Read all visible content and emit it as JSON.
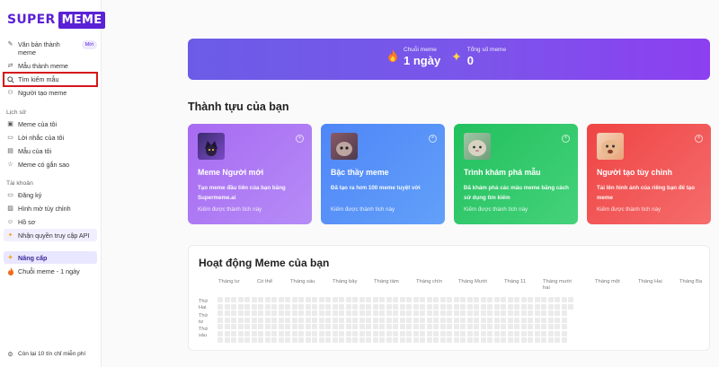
{
  "logo": {
    "part1": "SUPER",
    "part2": "MEME"
  },
  "sidebar": {
    "items": [
      {
        "label": "Văn bản thành meme",
        "icon": "pen-icon",
        "badge": "Mới"
      },
      {
        "label": "Mẫu thành meme",
        "icon": "image-swap-icon"
      },
      {
        "label": "Tìm kiếm mẫu",
        "icon": "search-icon"
      },
      {
        "label": "Người tạo meme",
        "icon": "person-plus-icon"
      }
    ],
    "history_title": "Lịch sử",
    "history": [
      {
        "label": "Meme của tôi",
        "icon": "image-icon"
      },
      {
        "label": "Lời nhắc của tôi",
        "icon": "message-icon"
      },
      {
        "label": "Mẫu của tôi",
        "icon": "template-icon"
      },
      {
        "label": "Meme có gắn sao",
        "icon": "star-icon"
      }
    ],
    "account_title": "Tài khoản",
    "account": [
      {
        "label": "Đăng ký",
        "icon": "card-icon"
      },
      {
        "label": "Hình mờ tùy chỉnh",
        "icon": "watermark-icon"
      },
      {
        "label": "Hồ sơ",
        "icon": "user-icon"
      },
      {
        "label": "Nhận quyền truy cập API",
        "icon": "sparkle-icon"
      }
    ],
    "upgrade": {
      "label": "Nâng cấp",
      "icon": "sparkle-icon"
    },
    "streak": {
      "label": "Chuỗi meme - 1 ngày",
      "icon": "fire-icon"
    },
    "bottom_note": "Còn lại 10 tín chỉ miễn phí"
  },
  "banner": {
    "streak_label": "Chuỗi meme",
    "streak_value": "1 ngày",
    "total_label": "Tổng số meme",
    "total_value": "0"
  },
  "achievements": {
    "title": "Thành tựu của bạn",
    "cards": [
      {
        "title": "Meme Người mới",
        "desc": "Tạo meme đầu tiên của bạn bằng Supermeme.ai",
        "earn": "Kiếm được thành tích này"
      },
      {
        "title": "Bậc thầy meme",
        "desc": "Đã tạo ra hơn 100 meme tuyệt vời",
        "earn": "Kiếm được thành tích này"
      },
      {
        "title": "Trình khám phá mẫu",
        "desc": "Đã khám phá các mẫu meme bằng cách sử dụng tìm kiếm",
        "earn": "Kiếm được thành tích này"
      },
      {
        "title": "Người tạo tùy chỉnh",
        "desc": "Tải lên hình ảnh của riêng bạn để tạo meme",
        "earn": "Kiếm được thành tích này"
      }
    ]
  },
  "activity": {
    "title": "Hoạt động Meme của bạn",
    "months": [
      "Tháng tư",
      "Có thể",
      "Tháng sáu",
      "Tháng bảy",
      "Tháng tám",
      "Tháng chín",
      "Tháng Mười",
      "Tháng 11",
      "Tháng mười hai",
      "Tháng một",
      "Tháng Hai",
      "Tháng Ba"
    ],
    "days": [
      "Thứ Hai",
      "Thứ tư",
      "Thứ sáu"
    ]
  }
}
